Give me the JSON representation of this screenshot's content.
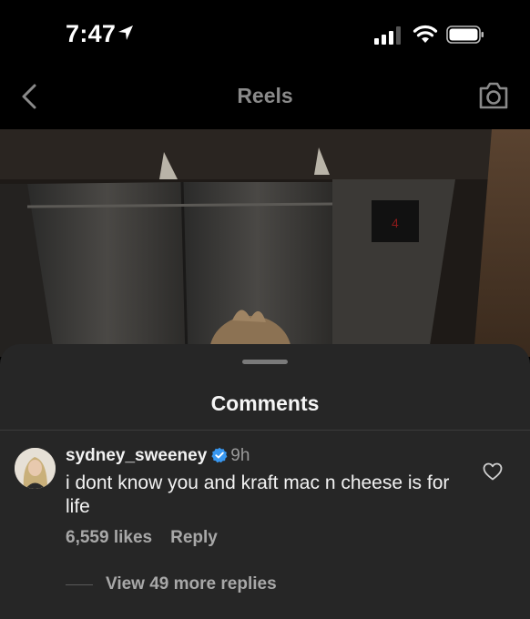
{
  "status_bar": {
    "time": "7:47"
  },
  "nav": {
    "title": "Reels"
  },
  "sheet": {
    "title": "Comments",
    "comment": {
      "username": "sydney_sweeney",
      "verified": true,
      "time": "9h",
      "text": "i dont know you and kraft mac n cheese is for life",
      "likes": "6,559 likes",
      "reply_label": "Reply"
    },
    "view_replies": "View 49 more replies"
  },
  "icons": {
    "back": "chevron-left-icon",
    "camera": "camera-icon",
    "heart": "heart-outline-icon",
    "verified": "verified-badge-icon"
  },
  "colors": {
    "background": "#000000",
    "sheet": "#262626",
    "verified_blue": "#3897f0",
    "muted_text": "#a8a8a8"
  }
}
